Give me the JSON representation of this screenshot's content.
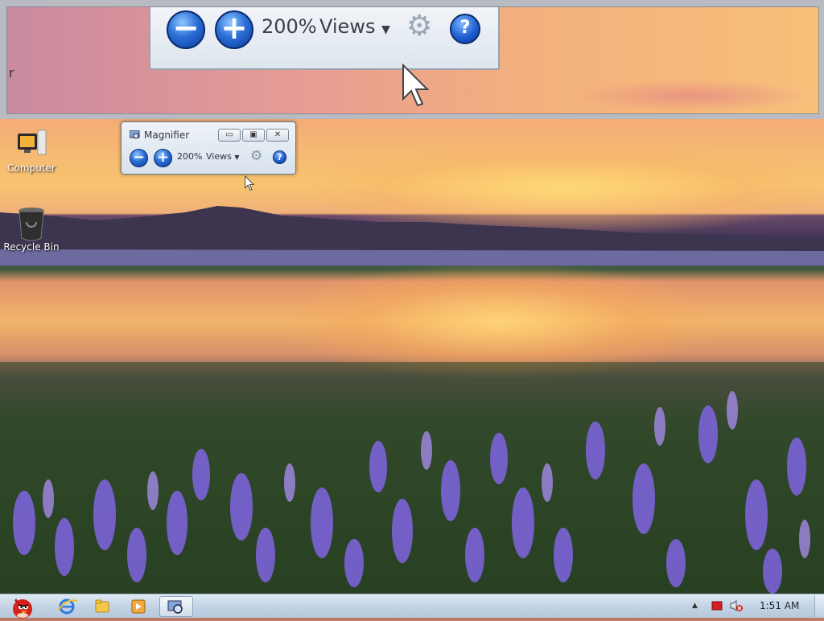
{
  "lens": {
    "zoom_level": "200%",
    "views_label": "Views",
    "minus_symbol": "−",
    "plus_symbol": "+",
    "gear_glyph": "⚙",
    "help_glyph": "?",
    "edge_glyph": "r"
  },
  "desktop": {
    "icons": [
      {
        "label": "Computer",
        "icon": "computer-icon"
      },
      {
        "label": "Recycle Bin",
        "icon": "recycle-bin-icon"
      }
    ]
  },
  "magnifier": {
    "title": "Magnifier",
    "zoom_level": "200%",
    "views_label": "Views",
    "minus_symbol": "−",
    "plus_symbol": "+",
    "gear_glyph": "⚙",
    "help_glyph": "?",
    "window_buttons": {
      "minimize": "▭",
      "maximize": "▣",
      "close": "✕"
    }
  },
  "taskbar": {
    "start_icon": "angry-bird-start-icon",
    "pinned": [
      "internet-explorer-icon",
      "windows-explorer-icon",
      "media-player-icon",
      "magnifier-taskbar-icon"
    ],
    "tray": {
      "show_hidden": "▲",
      "volume_muted": "muted-speaker-icon",
      "flag": "action-center-icon"
    },
    "clock": "1:51 AM"
  },
  "colors": {
    "accent_blue": "#2b6fd6",
    "taskbar": "#c3d3e5",
    "window_frame": "#dde5ee"
  }
}
